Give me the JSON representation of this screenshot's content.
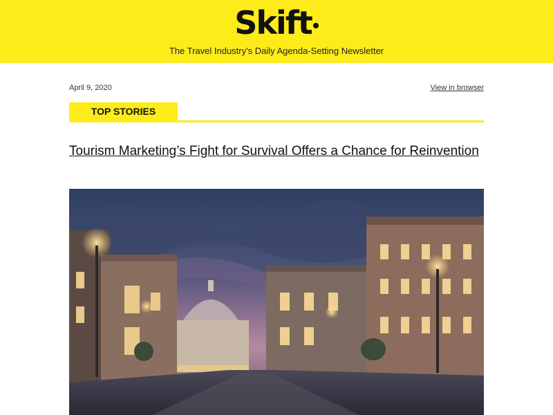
{
  "header": {
    "logo_text": "Skift",
    "tagline": "The Travel Industry's Daily Agenda-Setting Newsletter"
  },
  "meta": {
    "date": "April 9, 2020",
    "view_in_browser": "View in browser"
  },
  "section": {
    "label": "TOP STORIES"
  },
  "story": {
    "headline": "Tourism Marketing’s Fight for Survival Offers a Chance for Reinvention"
  },
  "colors": {
    "brand_yellow": "#fdec19",
    "text_dark": "#111111"
  }
}
